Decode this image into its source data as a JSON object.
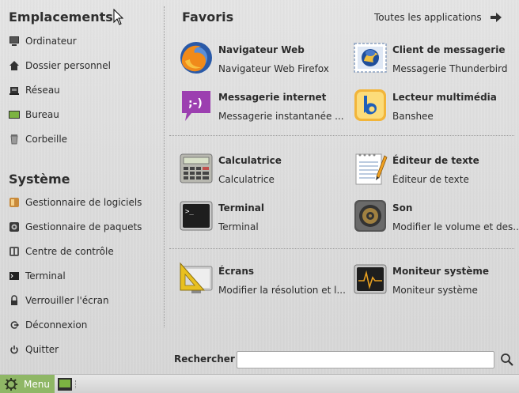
{
  "places": {
    "title": "Emplacements",
    "items": [
      {
        "label": "Ordinateur",
        "icon": "computer-icon"
      },
      {
        "label": "Dossier personnel",
        "icon": "home-icon"
      },
      {
        "label": "Réseau",
        "icon": "network-icon"
      },
      {
        "label": "Bureau",
        "icon": "desktop-icon"
      },
      {
        "label": "Corbeille",
        "icon": "trash-icon"
      }
    ]
  },
  "system": {
    "title": "Système",
    "items": [
      {
        "label": "Gestionnaire de logiciels",
        "icon": "software-manager-icon"
      },
      {
        "label": "Gestionnaire de paquets",
        "icon": "package-manager-icon"
      },
      {
        "label": "Centre de contrôle",
        "icon": "control-center-icon"
      },
      {
        "label": "Terminal",
        "icon": "terminal-icon"
      },
      {
        "label": "Verrouiller l'écran",
        "icon": "lock-icon"
      },
      {
        "label": "Déconnexion",
        "icon": "logout-icon"
      },
      {
        "label": "Quitter",
        "icon": "power-icon"
      }
    ]
  },
  "favorites": {
    "title": "Favoris",
    "all_apps": "Toutes les applications",
    "apps": [
      {
        "name": "Navigateur Web",
        "desc": "Navigateur Web Firefox",
        "icon": "firefox-icon"
      },
      {
        "name": "Client de messagerie",
        "desc": "Messagerie Thunderbird",
        "icon": "thunderbird-icon"
      },
      {
        "name": "Messagerie internet",
        "desc": "Messagerie instantanée ...",
        "icon": "pidgin-icon"
      },
      {
        "name": "Lecteur multimédia",
        "desc": "Banshee",
        "icon": "banshee-icon"
      },
      {
        "name": "Calculatrice",
        "desc": "Calculatrice",
        "icon": "calculator-icon"
      },
      {
        "name": "Éditeur de texte",
        "desc": "Éditeur de texte",
        "icon": "text-editor-icon"
      },
      {
        "name": "Terminal",
        "desc": "Terminal",
        "icon": "terminal-app-icon"
      },
      {
        "name": "Son",
        "desc": "Modifier le volume et des...",
        "icon": "speaker-icon"
      },
      {
        "name": "Écrans",
        "desc": "Modifier la résolution et l...",
        "icon": "display-icon"
      },
      {
        "name": "Moniteur système",
        "desc": "Moniteur système",
        "icon": "system-monitor-icon"
      }
    ]
  },
  "search": {
    "label": "Rechercher :",
    "value": ""
  },
  "taskbar": {
    "menu_label": "Menu"
  },
  "colors": {
    "menu_button": "#8fb766",
    "accent_orange": "#f0a020"
  }
}
